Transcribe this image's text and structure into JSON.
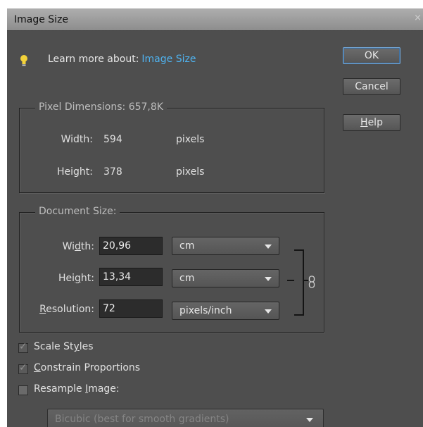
{
  "window": {
    "title": "Image Size",
    "close_glyph": "×"
  },
  "learn_more": {
    "prefix": "Learn more about:",
    "link": "Image Size",
    "icon": "lightbulb-icon"
  },
  "buttons": {
    "ok": "OK",
    "cancel": "Cancel",
    "help_first": "H",
    "help_rest": "elp"
  },
  "pixel_dimensions": {
    "legend": "Pixel Dimensions: 657,8K",
    "width_label": "Width:",
    "width_value": "594",
    "width_unit": "pixels",
    "height_label": "Height:",
    "height_value": "378",
    "height_unit": "pixels"
  },
  "document_size": {
    "legend": "Document Size:",
    "width_label_a": "Wi",
    "width_label_u": "d",
    "width_label_b": "th:",
    "width_value": "20,96",
    "width_unit": "cm",
    "height_label_a": "Hei",
    "height_label_u": "g",
    "height_label_b": "ht:",
    "height_value": "13,34",
    "height_unit": "cm",
    "resolution_label_u": "R",
    "resolution_label_b": "esolution:",
    "resolution_value": "72",
    "resolution_unit": "pixels/inch",
    "link_icon": "chain-link-icon"
  },
  "options": {
    "scale_styles_a": "Scale St",
    "scale_styles_u": "y",
    "scale_styles_b": "les",
    "scale_styles_checked": true,
    "constrain_u": "C",
    "constrain_b": "onstrain Proportions",
    "constrain_checked": true,
    "resample_a": "Resample ",
    "resample_u": "I",
    "resample_b": "mage:",
    "resample_checked": false,
    "check_glyph": "✓",
    "resample_method": "Bicubic (best for smooth gradients)"
  },
  "colors": {
    "background": "#4e4e4e",
    "link": "#4fb3f0",
    "titlebar": "#9d9d9d"
  }
}
